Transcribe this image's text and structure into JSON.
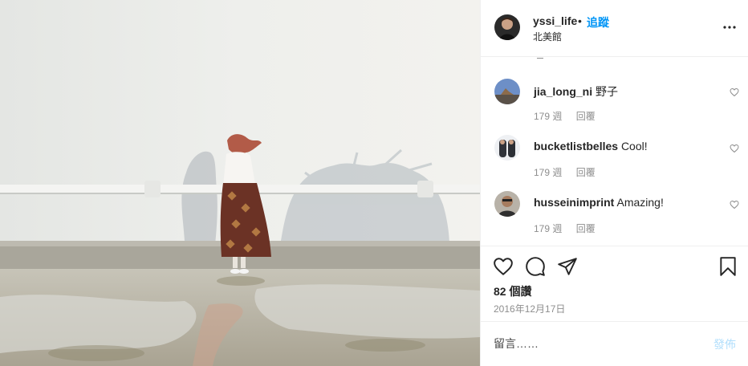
{
  "post": {
    "image_alt": "Woman standing in front of white wall with shadows",
    "username": "yssi_life",
    "separator": "•",
    "follow_label": "追蹤",
    "location": "北美館"
  },
  "comments": [
    {
      "username": "jia_long_ni",
      "text": "野子",
      "age": "179 週",
      "reply_label": "回覆"
    },
    {
      "username": "bucketlistbelles",
      "text": "Cool!",
      "age": "179 週",
      "reply_label": "回覆"
    },
    {
      "username": "husseinimprint",
      "text": "Amazing!",
      "age": "179 週",
      "reply_label": "回覆"
    }
  ],
  "actions": {
    "icons": [
      "heart-icon",
      "comment-icon",
      "share-icon",
      "bookmark-icon"
    ],
    "likes": "82 個讚",
    "date": "2016年12月17日"
  },
  "add_comment": {
    "placeholder": "留言……",
    "post_label": "發佈"
  },
  "colors": {
    "accent": "#0095f6",
    "post_disabled": "#b2dffc",
    "secondary_text": "#8e8e8e"
  }
}
